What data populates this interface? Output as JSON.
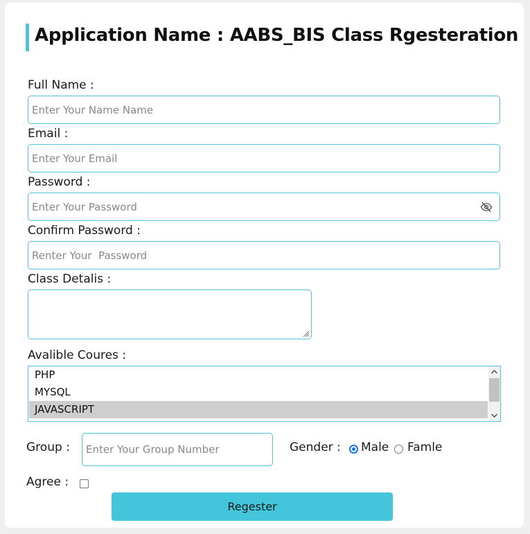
{
  "header": {
    "title": "Application Name : AABS_BIS Class Rgesteration"
  },
  "form": {
    "full_name": {
      "label": "Full Name :",
      "placeholder": "Enter Your Name Name",
      "value": ""
    },
    "email": {
      "label": "Email :",
      "placeholder": "Enter Your Email",
      "value": ""
    },
    "password": {
      "label": "Password :",
      "placeholder": "Enter Your Password",
      "value": "",
      "toggle_icon": "eye-slash-icon"
    },
    "confirm_password": {
      "label": "Confirm Password :",
      "placeholder": "Renter Your  Password",
      "value": ""
    },
    "class_details": {
      "label": "Class Detalis :",
      "value": ""
    },
    "courses": {
      "label": "Avalible Coures :",
      "options": [
        "PHP",
        "MYSQL",
        "JAVASCRIPT"
      ],
      "selected": "JAVASCRIPT"
    },
    "group": {
      "label": "Group :",
      "placeholder": "Enter Your Group Number",
      "value": ""
    },
    "gender": {
      "label": "Gender :",
      "options": [
        {
          "label": "Male",
          "checked": true
        },
        {
          "label": "Famle",
          "checked": false
        }
      ]
    },
    "agree": {
      "label": "Agree :",
      "checked": false
    },
    "submit_label": "Regester"
  },
  "colors": {
    "accent": "#4ec3db",
    "button": "#44c5db",
    "selected_option": "#cecece",
    "radio": "#1a73e8"
  }
}
